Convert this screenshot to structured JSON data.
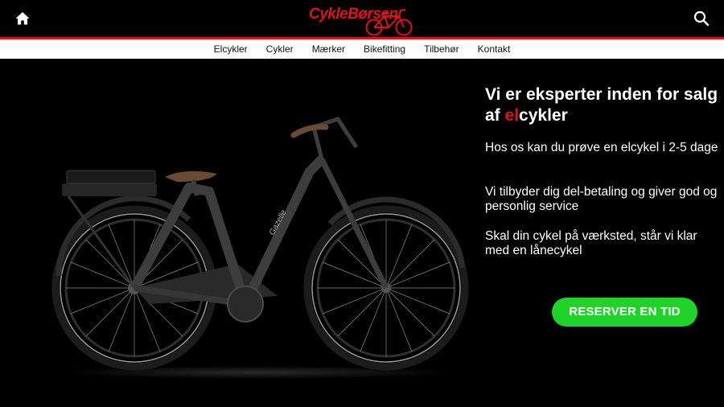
{
  "header": {
    "logo_text": "CykleBørsen",
    "home_icon": "home-icon",
    "search_icon": "search-icon",
    "accent_color": "#e3101b"
  },
  "nav": {
    "items": [
      {
        "label": "Elcykler"
      },
      {
        "label": "Cykler"
      },
      {
        "label": "Mærker"
      },
      {
        "label": "Bikefitting"
      },
      {
        "label": "Tilbehør"
      },
      {
        "label": "Kontakt"
      }
    ]
  },
  "hero": {
    "headline_part1": "Vi er eksperter inden for salg af ",
    "headline_accent": "el",
    "headline_part2": "cykler",
    "paragraph1": "Hos os kan du prøve en elcykel i 2-5 dage",
    "paragraph2": "Vi tilbyder dig del-betaling og giver god og personlig service",
    "paragraph3": "Skal din cykel på værksted, står vi klar med en lånecykel",
    "cta_label": "RESERVER EN TID",
    "cta_color": "#1fd32a",
    "bike_brand": "Gazelle"
  }
}
